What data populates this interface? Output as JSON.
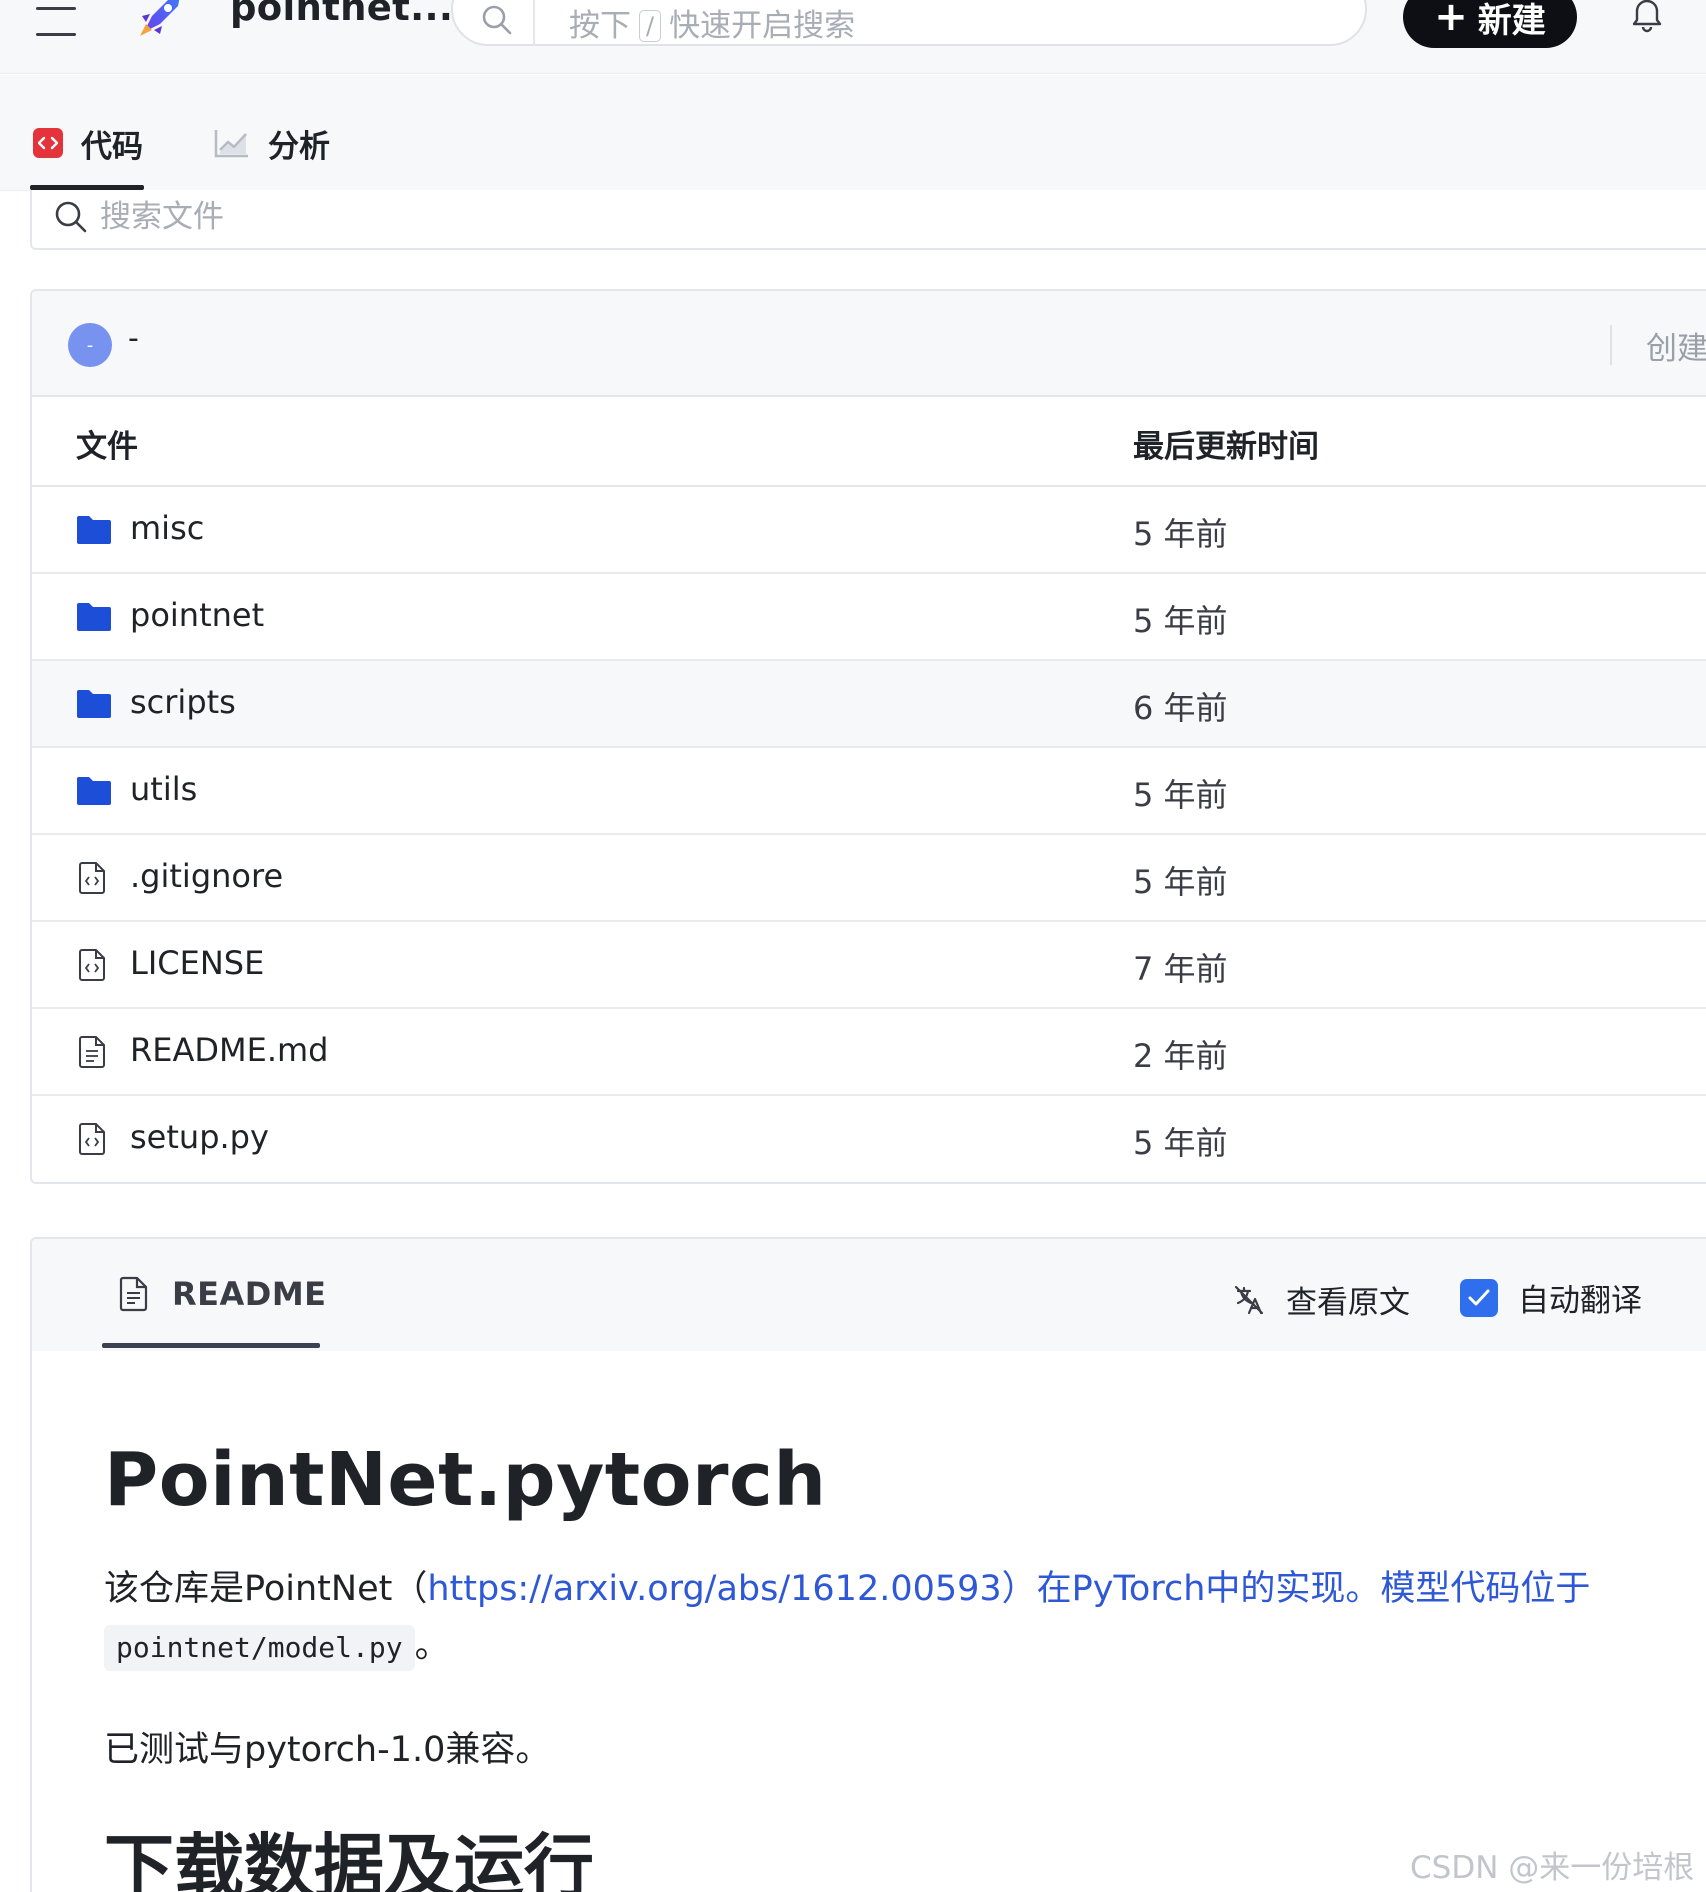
{
  "header": {
    "repo_name": "pointnet...",
    "search": {
      "prefix": "按下",
      "key": "/",
      "suffix": "快速开启搜索"
    },
    "new_button": "新建",
    "icons": [
      "menu-icon",
      "rocket-logo-icon",
      "search-icon",
      "plus-icon",
      "bell-icon"
    ]
  },
  "tabs": [
    {
      "label": "代码",
      "icon": "code-icon",
      "active": true
    },
    {
      "label": "分析",
      "icon": "chart-icon",
      "active": false
    }
  ],
  "file_search": {
    "placeholder": "搜索文件"
  },
  "commit": {
    "avatar_text": "-",
    "message": "-",
    "right_text": "创建"
  },
  "table": {
    "columns": [
      "文件",
      "最后更新时间"
    ],
    "rows": [
      {
        "type": "folder",
        "name": "misc",
        "time": "5 年前"
      },
      {
        "type": "folder",
        "name": "pointnet",
        "time": "5 年前"
      },
      {
        "type": "folder",
        "name": "scripts",
        "time": "6 年前"
      },
      {
        "type": "folder",
        "name": "utils",
        "time": "5 年前"
      },
      {
        "type": "file-code",
        "name": ".gitignore",
        "time": "5 年前"
      },
      {
        "type": "file-code",
        "name": "LICENSE",
        "time": "7 年前"
      },
      {
        "type": "file-text",
        "name": "README.md",
        "time": "2 年前"
      },
      {
        "type": "file-code",
        "name": "setup.py",
        "time": "5 年前"
      }
    ]
  },
  "readme": {
    "tab_label": "README",
    "view_original": "查看原文",
    "auto_translate": "自动翻译",
    "auto_translate_checked": true,
    "h1": "PointNet.pytorch",
    "p1_prefix": "该仓库是PointNet（",
    "p1_link": "https://arxiv.org/abs/1612.00593）在PyTorch中的实现。模型代码位于",
    "p1_code": "pointnet/model.py",
    "p1_suffix": "。",
    "p2": "已测试与pytorch-1.0兼容。",
    "h2": "下载数据及运行"
  },
  "watermark": "CSDN @来一份培根",
  "colors": {
    "accent_blue": "#2f58d6",
    "folder_blue": "#1d4ed8",
    "code_tab_red": "#e5333b",
    "checkbox_blue": "#2f6fed",
    "new_button_bg": "#0d0f14"
  }
}
